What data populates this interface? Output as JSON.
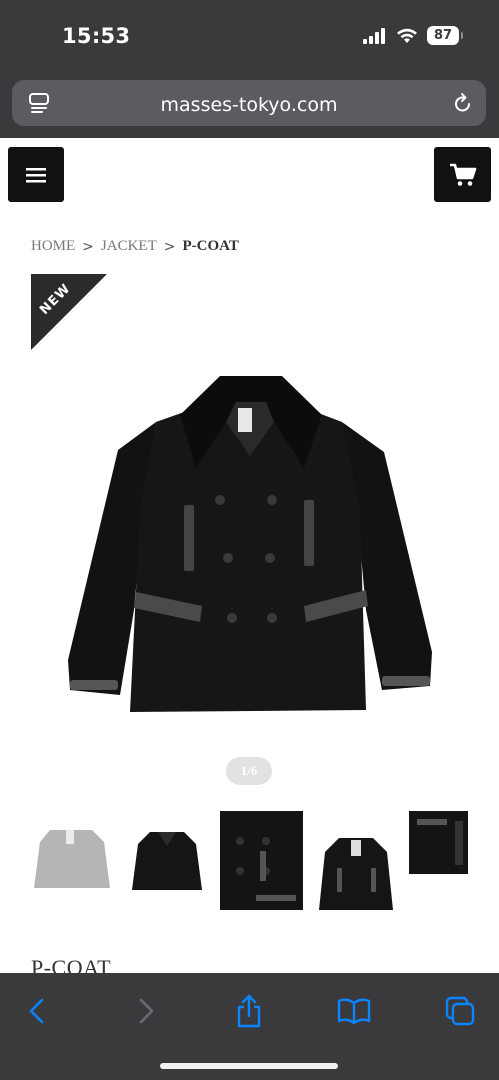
{
  "status_bar": {
    "time": "15:53",
    "battery": "87"
  },
  "browser": {
    "url": "masses-tokyo.com"
  },
  "header": {
    "menu_icon": "hamburger-menu-icon",
    "cart_icon": "shopping-cart-icon"
  },
  "breadcrumb": {
    "items": [
      "HOME",
      "JACKET"
    ],
    "current": "P-COAT",
    "separator": ">"
  },
  "badge": {
    "label": "NEW"
  },
  "gallery": {
    "indicator": "1/6",
    "thumbnail_count": 5
  },
  "product": {
    "title": "P-COAT"
  },
  "toolbar": {
    "icons": [
      "back-icon",
      "forward-icon",
      "share-icon",
      "bookmarks-icon",
      "tabs-icon"
    ]
  },
  "colors": {
    "accent": "#0a84ff",
    "bar": "#3a3a3c",
    "dark": "#111111"
  }
}
